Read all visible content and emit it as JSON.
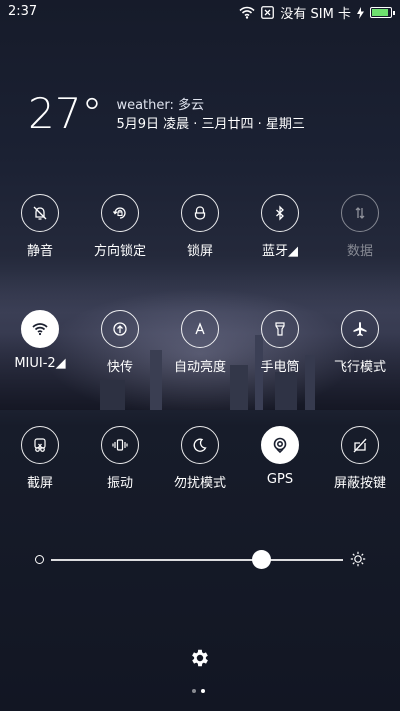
{
  "status": {
    "time": "2:37",
    "carrier": "没有 SIM 卡",
    "icons": [
      "wifi-icon",
      "sim-x-icon",
      "charging-icon",
      "battery-icon"
    ],
    "battery_level": 0.8
  },
  "weather": {
    "temperature": "27°",
    "line1": "weather:  多云",
    "line2": "5月9日 凌晨 · 三月廿四 · 星期三"
  },
  "toggles": [
    {
      "id": "mute",
      "label": "静音",
      "icon": "bell-off-icon",
      "state": "off"
    },
    {
      "id": "rotation-lock",
      "label": "方向锁定",
      "icon": "rotation-lock-icon",
      "state": "off"
    },
    {
      "id": "lock-screen",
      "label": "锁屏",
      "icon": "lock-icon",
      "state": "off"
    },
    {
      "id": "bluetooth",
      "label": "蓝牙◢",
      "icon": "bluetooth-icon",
      "state": "off"
    },
    {
      "id": "data",
      "label": "数据",
      "icon": "data-arrows-icon",
      "state": "disabled"
    },
    {
      "id": "wifi",
      "label": "MIUI-2◢",
      "icon": "wifi-icon",
      "state": "on"
    },
    {
      "id": "quick-transfer",
      "label": "快传",
      "icon": "upload-icon",
      "state": "off"
    },
    {
      "id": "auto-brightness",
      "label": "自动亮度",
      "icon": "auto-brightness-icon",
      "state": "off"
    },
    {
      "id": "flashlight",
      "label": "手电筒",
      "icon": "flashlight-icon",
      "state": "off"
    },
    {
      "id": "airplane",
      "label": "飞行模式",
      "icon": "airplane-icon",
      "state": "off"
    },
    {
      "id": "screenshot",
      "label": "截屏",
      "icon": "scissors-icon",
      "state": "off"
    },
    {
      "id": "vibrate",
      "label": "振动",
      "icon": "vibrate-icon",
      "state": "off"
    },
    {
      "id": "do-not-disturb",
      "label": "勿扰模式",
      "icon": "moon-icon",
      "state": "off"
    },
    {
      "id": "gps",
      "label": "GPS",
      "icon": "location-icon",
      "state": "on"
    },
    {
      "id": "block-keys",
      "label": "屏蔽按键",
      "icon": "block-keys-icon",
      "state": "off"
    }
  ],
  "brightness": {
    "level": 0.72,
    "min_icon": "brightness-low-icon",
    "max_icon": "brightness-high-icon"
  },
  "settings_icon": "gear-icon",
  "pages": {
    "total": 2,
    "current": 2
  }
}
